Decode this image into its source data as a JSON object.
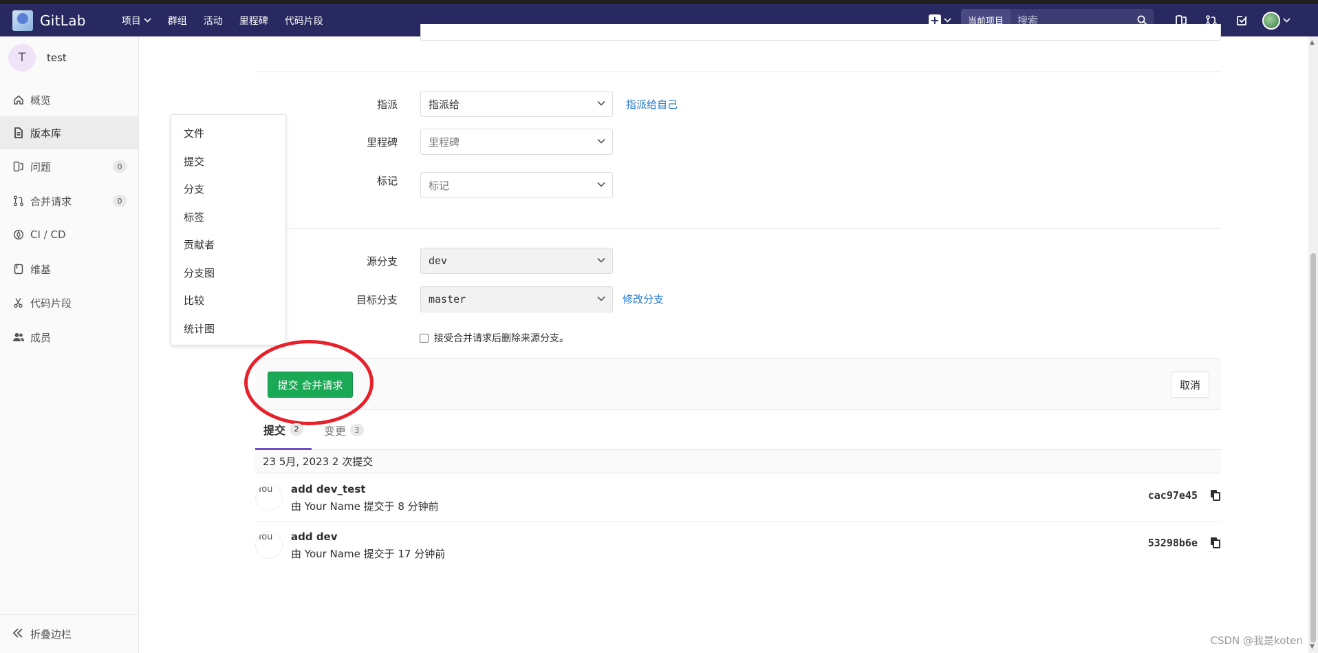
{
  "navbar": {
    "app_name": "GitLab",
    "links": [
      {
        "label": "项目",
        "has_dropdown": true
      },
      {
        "label": "群组",
        "has_dropdown": false
      },
      {
        "label": "活动",
        "has_dropdown": false
      },
      {
        "label": "里程碑",
        "has_dropdown": false
      },
      {
        "label": "代码片段",
        "has_dropdown": false
      }
    ],
    "search_scope": "当前项目",
    "search_placeholder": "搜索",
    "bg_color": "#292961"
  },
  "sidebar": {
    "project_initial": "T",
    "project_name": "test",
    "items": [
      {
        "label": "概览",
        "icon": "home-icon"
      },
      {
        "label": "版本库",
        "icon": "doc-icon",
        "active": true
      },
      {
        "label": "问题",
        "icon": "issues-icon",
        "count": "0"
      },
      {
        "label": "合并请求",
        "icon": "merge-request-icon",
        "count": "0"
      },
      {
        "label": "CI / CD",
        "icon": "rocket-icon"
      },
      {
        "label": "维基",
        "icon": "book-icon"
      },
      {
        "label": "代码片段",
        "icon": "scissors-icon"
      },
      {
        "label": "成员",
        "icon": "users-icon"
      }
    ],
    "collapse_label": "折叠边栏"
  },
  "flyout": {
    "items": [
      "文件",
      "提交",
      "分支",
      "标签",
      "贡献者",
      "分支图",
      "比较",
      "统计图"
    ]
  },
  "form": {
    "assignee_label": "指派",
    "assignee_value": "指派给",
    "assign_self_link": "指派给自己",
    "milestone_label": "里程碑",
    "milestone_value": "里程碑",
    "labels_label": "标记",
    "labels_value": "标记",
    "source_branch_label": "源分支",
    "source_branch_value": "dev",
    "target_branch_label": "目标分支",
    "target_branch_value": "master",
    "change_branch_link": "修改分支",
    "remove_source_checkbox": "接受合并请求后删除来源分支。",
    "remove_source_checked": false
  },
  "actions": {
    "submit_label": "提交 合并请求",
    "cancel_label": "取消",
    "submit_color": "#1aaa55",
    "annotation_color": "#e8202a"
  },
  "tabs": [
    {
      "label": "提交",
      "count": "2",
      "active": true
    },
    {
      "label": "变更",
      "count": "3",
      "active": false
    }
  ],
  "commits": {
    "day_header": "23 5月, 2023 2 次提交",
    "list": [
      {
        "avatar_alt": "You",
        "title": "add dev_test",
        "meta": "由 Your Name 提交于 8 分钟前",
        "sha": "cac97e45"
      },
      {
        "avatar_alt": "You",
        "title": "add dev",
        "meta": "由 Your Name 提交于 17 分钟前",
        "sha": "53298b6e"
      }
    ]
  },
  "watermark": "CSDN @我是koten"
}
